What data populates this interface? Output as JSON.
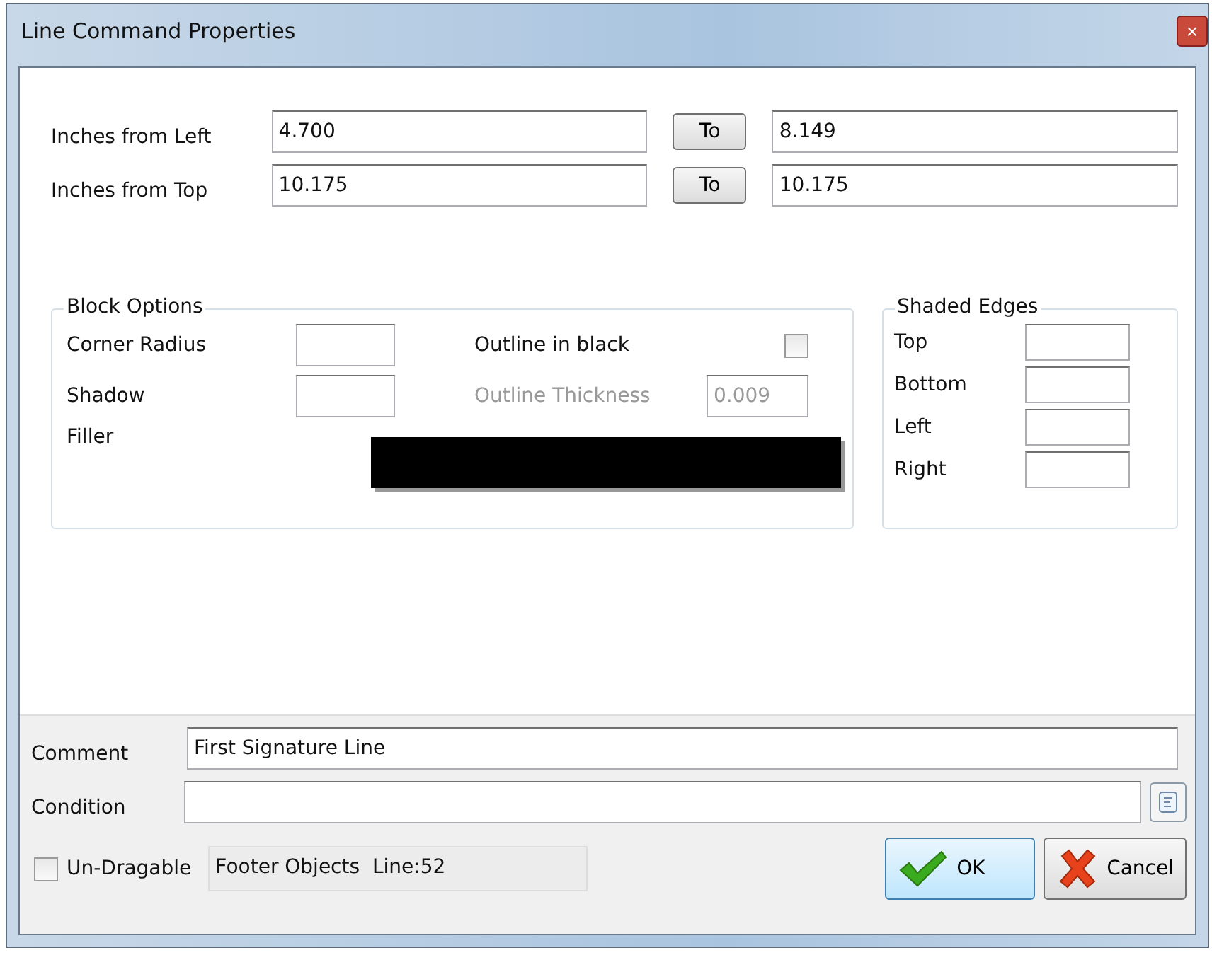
{
  "window": {
    "title": "Line Command Properties",
    "close": "×"
  },
  "position_rows": [
    {
      "label": "Inches from Left",
      "from": "4.700",
      "button": "To",
      "to": "8.149"
    },
    {
      "label": "Inches from Top",
      "from": "10.175",
      "button": "To",
      "to": "10.175"
    }
  ],
  "block_options": {
    "title": "Block Options",
    "corner_radius_label": "Corner Radius",
    "shadow_label": "Shadow",
    "filler_label": "Filler",
    "filler": {
      "color": "#000000"
    },
    "outline_label": "Outline in black",
    "outline_checked": false,
    "thickness_label": "Outline Thickness",
    "thickness_value": "0.009",
    "thickness_disabled": true
  },
  "shaded_edges": {
    "title": "Shaded Edges",
    "edges": [
      "Top",
      "Bottom",
      "Left",
      "Right"
    ]
  },
  "comment": {
    "label": "Comment",
    "value": "First Signature Line"
  },
  "condition": {
    "label": "Condition"
  },
  "footer": {
    "undragable_label": "Un-Dragable",
    "undragable_checked": false,
    "status": "Footer Objects  Line:52",
    "ok": "OK",
    "cancel": "Cancel"
  }
}
